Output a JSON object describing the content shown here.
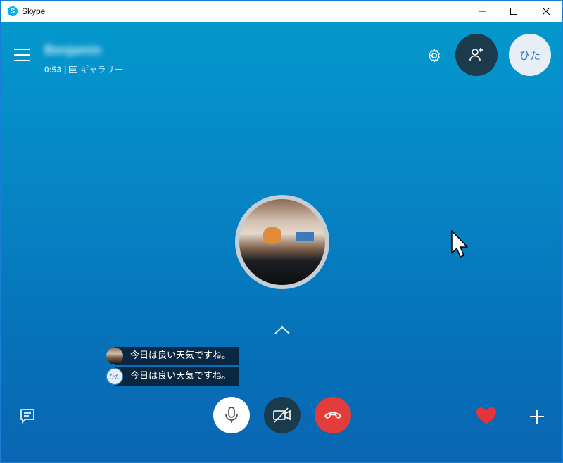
{
  "window": {
    "title": "Skype",
    "app_icon_letter": "S"
  },
  "call": {
    "contact_name": "Benjamin",
    "duration": "0:53",
    "separator": "|",
    "view_mode": "ギャラリー",
    "self_initials": "ひた"
  },
  "chat": {
    "messages": [
      {
        "text": "今日は良い天気ですね。",
        "sender": "remote"
      },
      {
        "text": "今日は良い天気ですね。",
        "sender": "self",
        "initials": "ひた"
      }
    ]
  },
  "colors": {
    "background_top": "#0498cc",
    "background_bottom": "#0a66b3",
    "end_call": "#e23d3a",
    "dark_button": "#1b3a4c",
    "heart": "#e8333c"
  },
  "icons": {
    "menu": "hamburger-icon",
    "settings": "gear-icon",
    "add_people": "add-person-icon",
    "mic": "microphone-icon",
    "video": "video-off-icon",
    "end": "phone-hangup-icon",
    "react": "heart-icon",
    "more": "plus-icon",
    "chat": "chat-icon",
    "expand": "chevron-up-icon"
  }
}
